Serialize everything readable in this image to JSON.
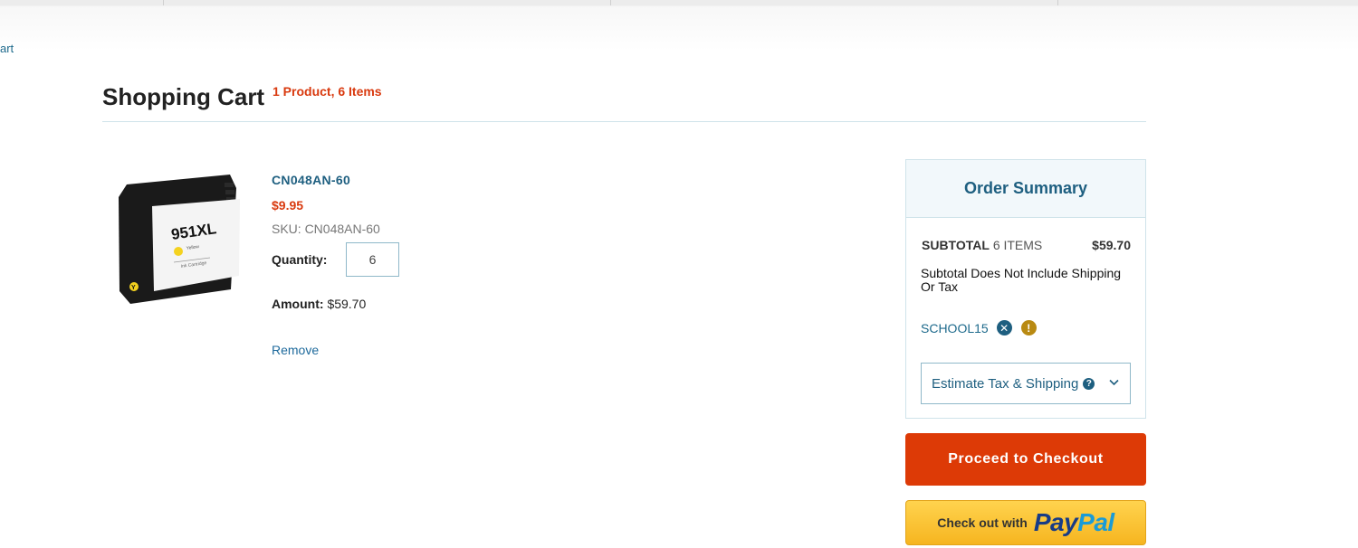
{
  "breadcrumb": {
    "text": "art"
  },
  "page": {
    "title": "Shopping Cart",
    "count": "1 Product, 6 Items"
  },
  "item": {
    "image_label": "951XL",
    "image_sublabel": "Yellow",
    "image_type": "Ink Cartridge",
    "image_letter": "Y",
    "name": "CN048AN-60",
    "price": "$9.95",
    "sku": "SKU: CN048AN-60",
    "quantity_label": "Quantity:",
    "quantity_value": "6",
    "amount_label": "Amount:",
    "amount_value": "$59.70",
    "remove_label": "Remove"
  },
  "summary": {
    "title": "Order Summary",
    "subtotal_label": "SUBTOTAL",
    "subtotal_items": "6 ITEMS",
    "subtotal_value": "$59.70",
    "note": "Subtotal Does Not Include Shipping Or Tax",
    "coupon_code": "SCHOOL15",
    "remove_coupon_icon": "close-circle-icon",
    "warning_icon": "exclamation-circle-icon",
    "estimate_label": "Estimate Tax & Shipping",
    "help_icon": "question-circle-icon",
    "chevron_icon": "chevron-down-icon"
  },
  "checkout_label": "Proceed to Checkout",
  "paypal": {
    "prefix": "Check out with",
    "logo_part1": "Pay",
    "logo_part2": "Pal"
  },
  "colors": {
    "accent_orange": "#dd3a06",
    "link_blue": "#1e5f80",
    "paypal_yellow": "#f6b520",
    "paypal_dark_blue": "#173b86",
    "paypal_light_blue": "#1a9bd7"
  }
}
